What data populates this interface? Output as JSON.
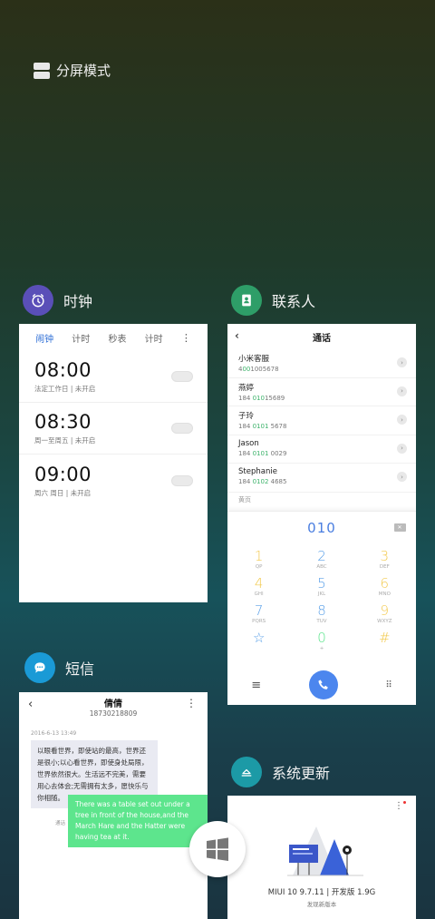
{
  "split_mode": {
    "label": "分屏模式",
    "icon": "split-screen-icon"
  },
  "clock": {
    "app_name": "时钟",
    "icon": "clock-icon",
    "icon_color": "#5a4fb8",
    "tabs": [
      "闹钟",
      "计时",
      "秒表",
      "计时"
    ],
    "alarms": [
      {
        "time": "08:00",
        "desc": "法定工作日 | 未开启"
      },
      {
        "time": "08:30",
        "desc": "周一至周五 | 未开启"
      },
      {
        "time": "09:00",
        "desc": "周六 周日 | 未开启"
      }
    ]
  },
  "contacts": {
    "app_name": "联系人",
    "icon": "contacts-book-icon",
    "icon_color": "#2e9e68",
    "title": "通话",
    "list": [
      {
        "name": "小米客服",
        "pre": "4",
        "hl": "00",
        "post": "1005678"
      },
      {
        "name": "燕婷",
        "pre": "184 ",
        "hl": "010",
        "post": "15689"
      },
      {
        "name": "子玲",
        "pre": "184 ",
        "hl": "0101",
        "post": " 5678"
      },
      {
        "name": "Jason",
        "pre": "184 ",
        "hl": "0101",
        "post": " 0029"
      },
      {
        "name": "Stephanie",
        "pre": "184 ",
        "hl": "0102",
        "post": " 4685"
      }
    ],
    "more": "黄页",
    "dial_number": "010",
    "keys": [
      {
        "d": "1",
        "l": "QP",
        "c": "#f2c94c"
      },
      {
        "d": "2",
        "l": "ABC",
        "c": "#5aa0e8"
      },
      {
        "d": "3",
        "l": "DEF",
        "c": "#f2c94c"
      },
      {
        "d": "4",
        "l": "GHI",
        "c": "#f2c94c"
      },
      {
        "d": "5",
        "l": "JKL",
        "c": "#5aa0e8"
      },
      {
        "d": "6",
        "l": "MNO",
        "c": "#f2c94c"
      },
      {
        "d": "7",
        "l": "PQRS",
        "c": "#5aa0e8"
      },
      {
        "d": "8",
        "l": "TUV",
        "c": "#5aa0e8"
      },
      {
        "d": "9",
        "l": "WXYZ",
        "c": "#f2c94c"
      },
      {
        "d": "☆",
        "l": "",
        "c": "#5aa0e8"
      },
      {
        "d": "0",
        "l": "+",
        "c": "#5de58d"
      },
      {
        "d": "#",
        "l": "",
        "c": "#f2c94c"
      }
    ]
  },
  "messages": {
    "app_name": "短信",
    "icon": "chat-bubble-icon",
    "icon_color": "#1a9ad6",
    "contact_name": "倩倩",
    "contact_number": "18730218809",
    "date": "2016-6-13 13:49",
    "incoming": "以眼看世界，即使站的最高，世界还是很小;以心看世界，即使身处局限，世界依然很大。生活远不完美，需要用心去体会;无需拥有太多，愿快乐与你相随。",
    "outgoing": "There was a table set out under a tree in front of the house,and the March Hare and the Hatter were having tea at it.",
    "side_label": "通话"
  },
  "update": {
    "app_name": "系统更新",
    "icon": "update-arrow-icon",
    "icon_color": "#1c9aa6",
    "version": "MIUI 10 9.7.11 | 开发版 1.9G",
    "subtitle": "发现新版本"
  },
  "windows_button": {
    "icon": "windows-grid-icon"
  }
}
